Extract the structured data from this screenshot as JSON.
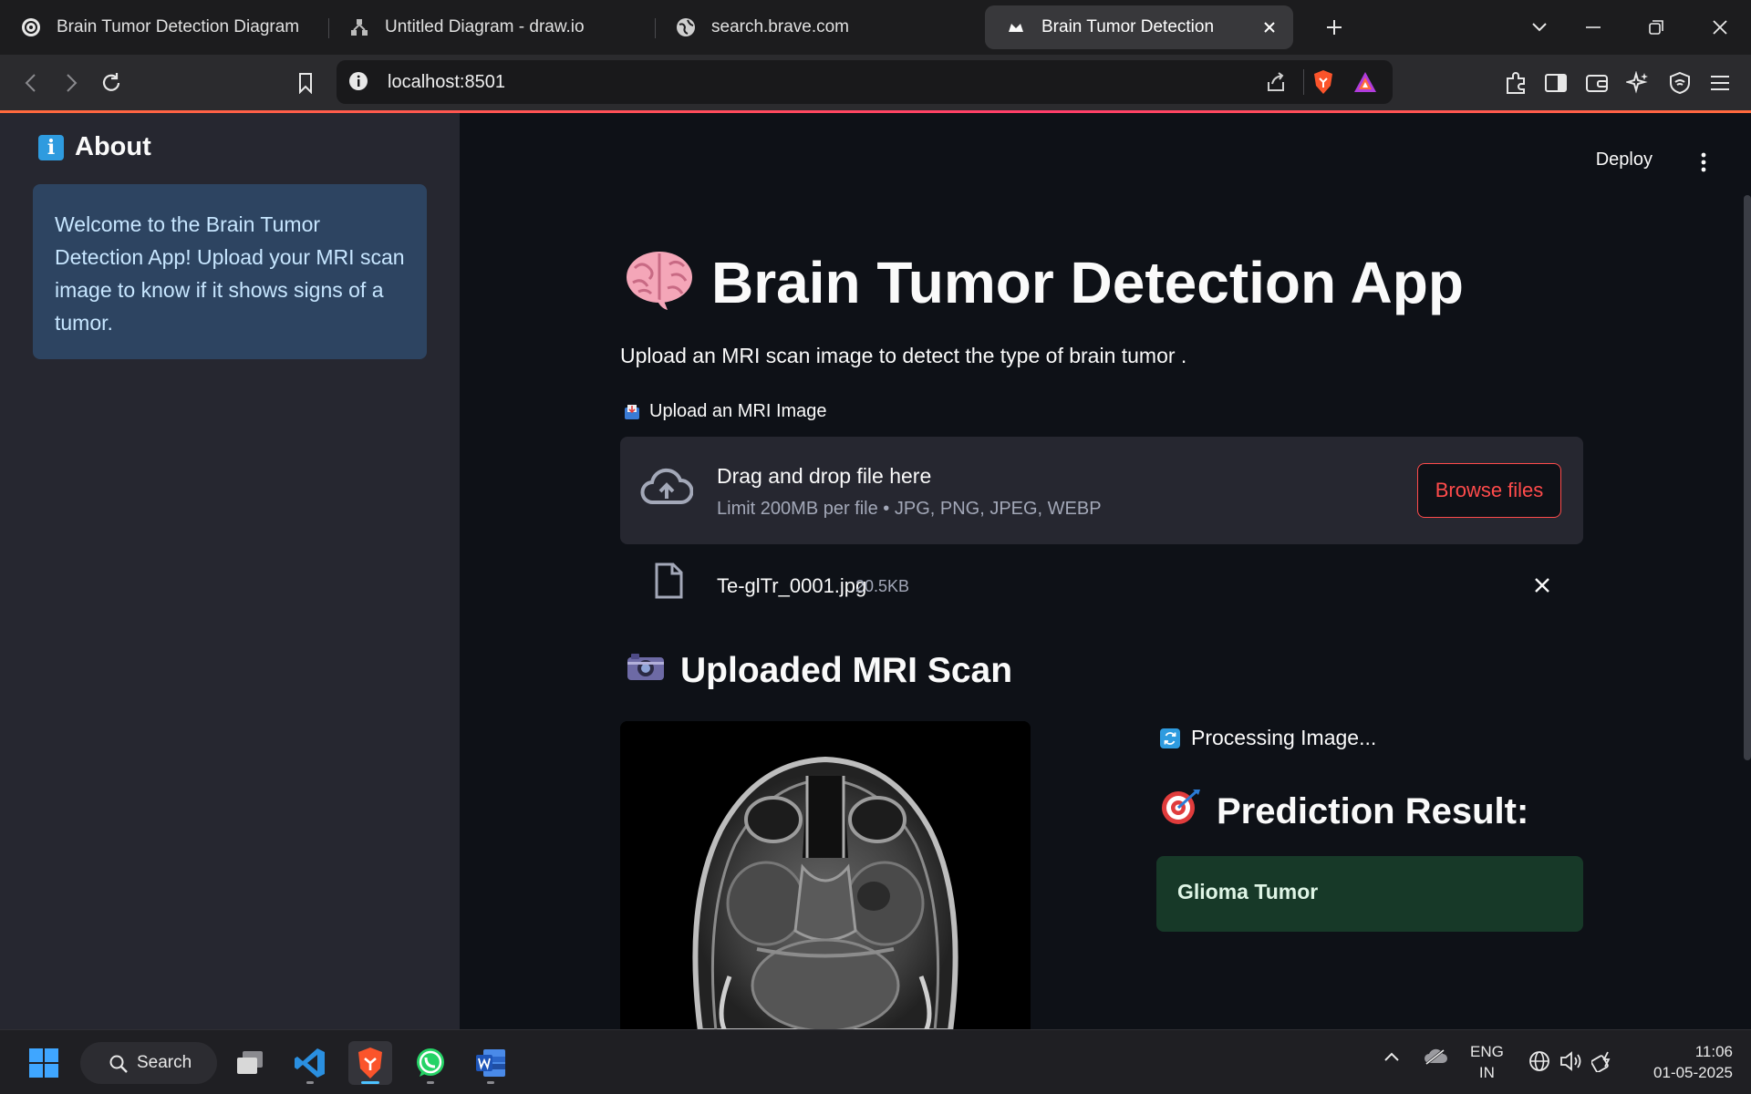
{
  "browser": {
    "tabs": [
      {
        "title": "Brain Tumor Detection Diagram",
        "icon": "openai-icon",
        "active": false
      },
      {
        "title": "Untitled Diagram - draw.io",
        "icon": "drawio-icon",
        "active": false
      },
      {
        "title": "search.brave.com",
        "icon": "globe-icon",
        "active": false
      },
      {
        "title": "Brain Tumor Detection",
        "icon": "streamlit-icon",
        "active": true
      }
    ],
    "url": "localhost:8501"
  },
  "app": {
    "deploy_label": "Deploy",
    "sidebar": {
      "about_title": "About",
      "about_text": "Welcome to the Brain Tumor Detection App! Upload your MRI scan image to know if it shows signs of a tumor."
    },
    "title": "Brain Tumor Detection App",
    "title_emoji": "🧠",
    "subtitle": "Upload an MRI scan image to detect the type of brain tumor .",
    "uploader": {
      "label": "Upload an MRI Image",
      "drop_text": "Drag and drop file here",
      "limit_text": "Limit 200MB per file • JPG, PNG, JPEG, WEBP",
      "browse_label": "Browse files"
    },
    "file": {
      "name": "Te-glTr_0001.jpg",
      "size": "20.5KB"
    },
    "scan_header": "Uploaded MRI Scan",
    "processing_text": "Processing Image...",
    "prediction_header": "Prediction Result:",
    "prediction_value": "Glioma Tumor"
  },
  "taskbar": {
    "search_label": "Search",
    "lang_line1": "ENG",
    "lang_line2": "IN",
    "time": "11:06",
    "date": "01-05-2025"
  },
  "colors": {
    "accent_red": "#ff4b4b",
    "info_bg": "#2d4461",
    "success_bg": "#173928",
    "sidebar_bg": "#262730",
    "main_bg": "#0e1117"
  }
}
